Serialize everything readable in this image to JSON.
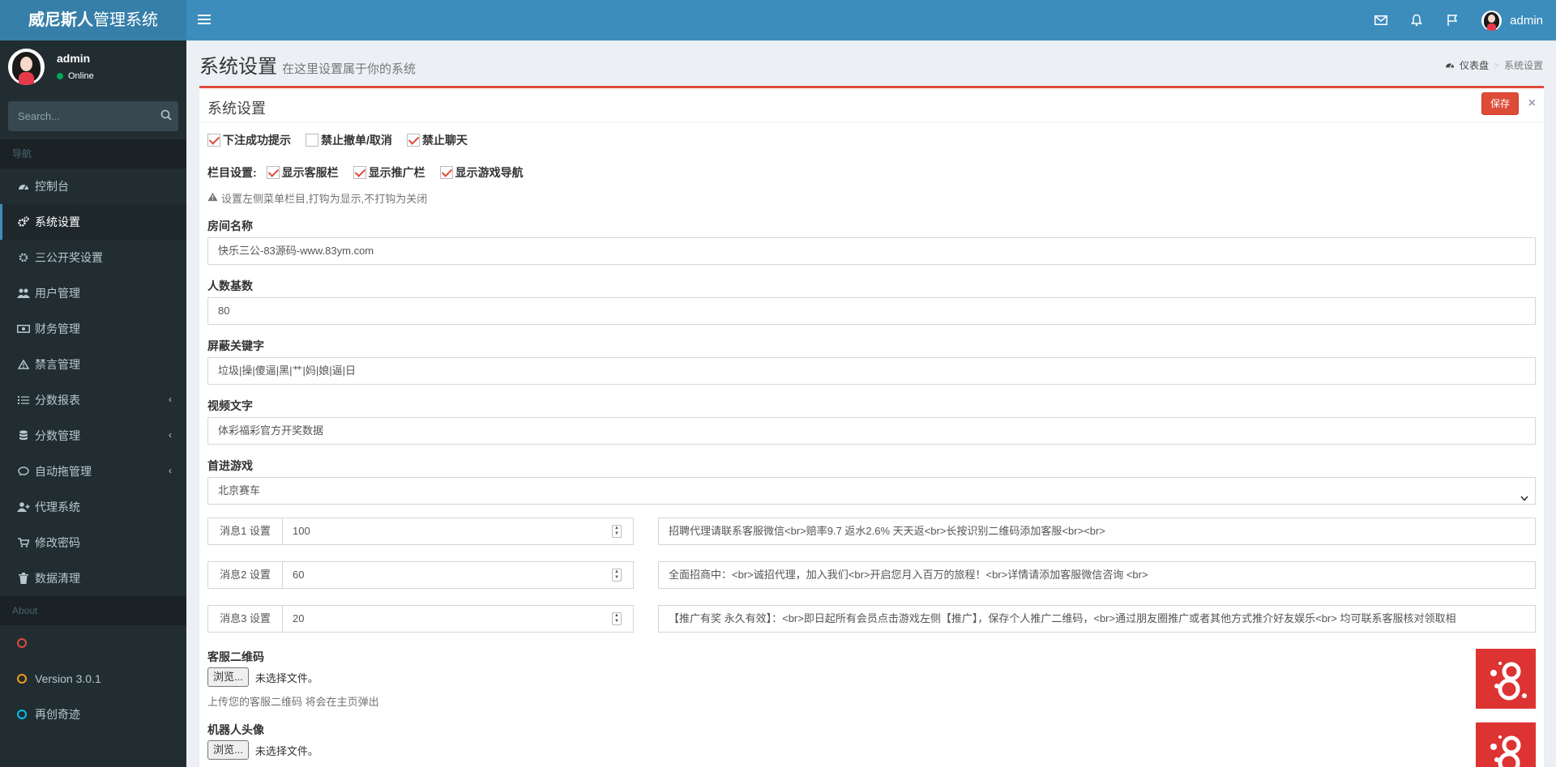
{
  "header": {
    "logo_bold": "威尼斯人",
    "logo_rest": "管理系统",
    "username": "admin"
  },
  "sidebar": {
    "user": {
      "name": "admin",
      "status": "Online"
    },
    "search_placeholder": "Search...",
    "nav_header": "导航",
    "items": [
      {
        "label": "控制台",
        "icon": "dashboard-icon"
      },
      {
        "label": "系统设置",
        "icon": "cogs-icon"
      },
      {
        "label": "三公开奖设置",
        "icon": "gear-icon"
      },
      {
        "label": "用户管理",
        "icon": "users-icon"
      },
      {
        "label": "财务管理",
        "icon": "money-icon"
      },
      {
        "label": "禁言管理",
        "icon": "warning-icon"
      },
      {
        "label": "分数报表",
        "icon": "list-icon"
      },
      {
        "label": "分数管理",
        "icon": "database-icon"
      },
      {
        "label": "自动拖管理",
        "icon": "comment-icon"
      },
      {
        "label": "代理系统",
        "icon": "user-plus-icon"
      },
      {
        "label": "修改密码",
        "icon": "cart-icon"
      },
      {
        "label": "数据清理",
        "icon": "trash-icon"
      }
    ],
    "about_header": "About",
    "about_items": [
      {
        "label": "",
        "color": "#dd4b39"
      },
      {
        "label": "Version 3.0.1",
        "color": "#f39c12"
      },
      {
        "label": "再创奇迹",
        "color": "#00c0ef"
      }
    ]
  },
  "page": {
    "title": "系统设置",
    "subtitle": "在这里设置属于你的系统",
    "breadcrumb_home": "仪表盘",
    "breadcrumb_current": "系统设置"
  },
  "box": {
    "title": "系统设置",
    "save_label": "保存",
    "close_label": "×"
  },
  "options": {
    "bet_success": {
      "label": "下注成功提示",
      "checked": true
    },
    "no_cancel": {
      "label": "禁止撤单/取消",
      "checked": false
    },
    "no_chat": {
      "label": "禁止聊天",
      "checked": true
    }
  },
  "columns": {
    "label": "栏目设置:",
    "service": {
      "label": "显示客服栏",
      "checked": true
    },
    "promo": {
      "label": "显示推广栏",
      "checked": true
    },
    "gamenav": {
      "label": "显示游戏导航",
      "checked": true
    },
    "hint": "设置左侧菜单栏目,打钩为显示,不打钩为关闭"
  },
  "form": {
    "room_name": {
      "label": "房间名称",
      "value": "快乐三公-83源码-www.83ym.com"
    },
    "base_count": {
      "label": "人数基数",
      "value": "80"
    },
    "keywords": {
      "label": "屏蔽关键字",
      "value": "垃圾|操|傻逼|黑|艹|妈|娘|逼|日"
    },
    "video_text": {
      "label": "视频文字",
      "value": "体彩福彩官方开奖数据"
    },
    "first_game": {
      "label": "首进游戏",
      "value": "北京赛车"
    }
  },
  "messages": [
    {
      "addon": "消息1 设置",
      "num": "100",
      "text": "招聘代理请联系客服微信<br>赔率9.7 返水2.6% 天天返<br>长按识别二维码添加客服<br><br>"
    },
    {
      "addon": "消息2 设置",
      "num": "60",
      "text": "全面招商中：<br>诚招代理，加入我们<br>开启您月入百万的旅程！<br>详情请添加客服微信咨询 <br>"
    },
    {
      "addon": "消息3 设置",
      "num": "20",
      "text": "【推广有奖  永久有效】：<br>即日起所有会员点击游戏左侧【推广】，保存个人推广二维码，<br>通过朋友圈推广或者其他方式推介好友娱乐<br> 均可联系客服核对领取相"
    }
  ],
  "uploads": {
    "qr": {
      "label": "客服二维码",
      "browse": "浏览...",
      "status": "未选择文件。",
      "help": "上传您的客服二维码 将会在主页弹出"
    },
    "robot": {
      "label": "机器人头像",
      "browse": "浏览...",
      "status": "未选择文件。"
    }
  },
  "colors": {
    "brand": "#3c8dbc",
    "danger": "#dd4b39",
    "sidebar": "#222d32"
  }
}
